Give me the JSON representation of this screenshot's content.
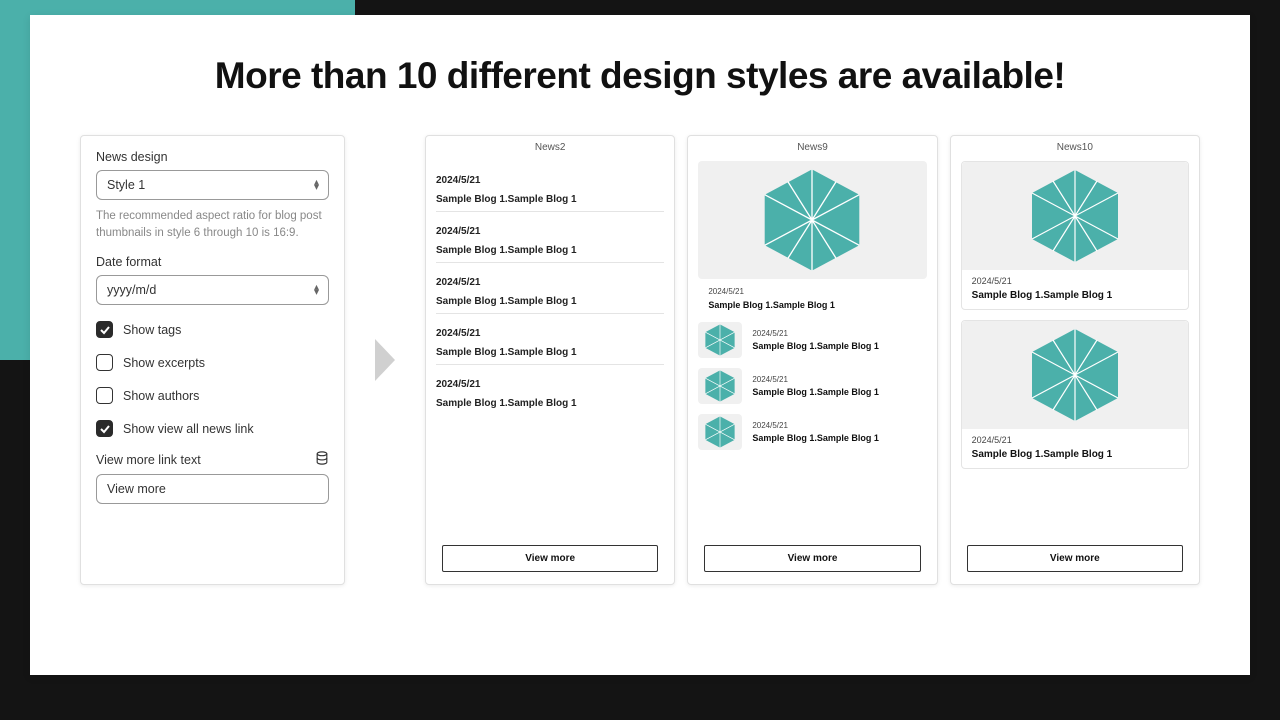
{
  "colors": {
    "teal": "#4bb0aa"
  },
  "hero": {
    "title": "More than 10 different design styles are available!"
  },
  "settings": {
    "news_design_label": "News design",
    "style_value": "Style 1",
    "style_hint": "The recommended aspect ratio for blog post thumbnails in style 6 through 10 is 16:9.",
    "date_format_label": "Date format",
    "date_format_value": "yyyy/m/d",
    "opt_show_tags": "Show tags",
    "opt_show_excerpts": "Show excerpts",
    "opt_show_authors": "Show authors",
    "opt_show_viewall": "Show view all news link",
    "viewmore_label": "View more link text",
    "viewmore_value": "View more"
  },
  "previews": {
    "news2": {
      "title": "News2",
      "items": [
        {
          "date": "2024/5/21",
          "title": "Sample Blog 1.Sample Blog 1"
        },
        {
          "date": "2024/5/21",
          "title": "Sample Blog 1.Sample Blog 1"
        },
        {
          "date": "2024/5/21",
          "title": "Sample Blog 1.Sample Blog 1"
        },
        {
          "date": "2024/5/21",
          "title": "Sample Blog 1.Sample Blog 1"
        },
        {
          "date": "2024/5/21",
          "title": "Sample Blog 1.Sample Blog 1"
        }
      ],
      "view_more": "View more"
    },
    "news9": {
      "title": "News9",
      "featured": {
        "date": "2024/5/21",
        "title": "Sample Blog 1.Sample Blog 1"
      },
      "items": [
        {
          "date": "2024/5/21",
          "title": "Sample Blog 1.Sample Blog 1"
        },
        {
          "date": "2024/5/21",
          "title": "Sample Blog 1.Sample Blog 1"
        },
        {
          "date": "2024/5/21",
          "title": "Sample Blog 1.Sample Blog 1"
        }
      ],
      "view_more": "View more"
    },
    "news10": {
      "title": "News10",
      "cards": [
        {
          "date": "2024/5/21",
          "title": "Sample Blog 1.Sample Blog 1"
        },
        {
          "date": "2024/5/21",
          "title": "Sample Blog 1.Sample Blog 1"
        }
      ],
      "view_more": "View more"
    }
  }
}
